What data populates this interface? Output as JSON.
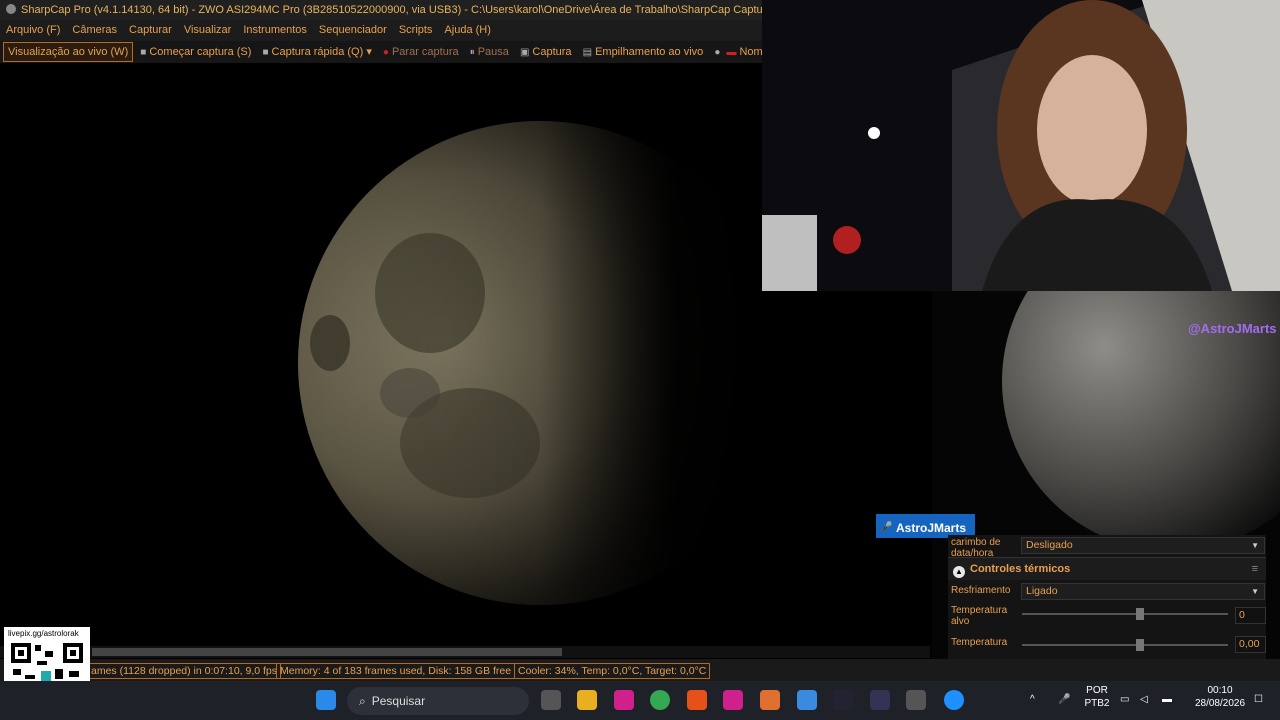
{
  "window": {
    "title": "SharpCap Pro (v4.1.14130, 64 bit) - ZWO ASI294MC Pro (3B28510522000900, via USB3) - C:\\Users\\karol\\OneDrive\\Área de Trabalho\\SharpCap Captures"
  },
  "menu": [
    "Arquivo (F)",
    "Câmeras",
    "Capturar",
    "Visualizar",
    "Instrumentos",
    "Sequenciador",
    "Scripts",
    "Ajuda (H)"
  ],
  "toolbar": {
    "live_view": "Visualização ao vivo (W)",
    "start_capture": "Começar captura (S)",
    "quick_capture": "Captura rápida (Q)",
    "stop_capture": "Parar captura",
    "pause": "Pausa",
    "snapshot": "Captura",
    "live_stack": "Empilhamento ao vivo",
    "target_name": "Nome de destino"
  },
  "status": {
    "frames": "ames (1128 dropped) in 0:07:10, 9,0 fps",
    "memory": "Memory: 4 of 183 frames used, Disk: 158 GB free",
    "cooler": "Cooler: 34%, Temp: 0,0°C, Target: 0,0°C"
  },
  "overlay": {
    "handle": "@AstroJMarts",
    "name_badge": "AstroJMarts",
    "qr_label": "livepix.gg/astrolorak"
  },
  "panel": {
    "timestamp_label": "carimbo de data/hora",
    "timestamp_value": "Desligado",
    "thermal_title": "Controles térmicos",
    "cooling_label": "Resfriamento",
    "cooling_value": "Ligado",
    "target_temp_label": "Temperatura alvo",
    "target_temp_value": "0",
    "temp_label": "Temperatura",
    "temp_value": "0,00"
  },
  "taskbar": {
    "search_placeholder": "Pesquisar",
    "lang_top": "POR",
    "lang_bottom": "PTB2",
    "time": "00:10",
    "date": "28/08/2026"
  }
}
